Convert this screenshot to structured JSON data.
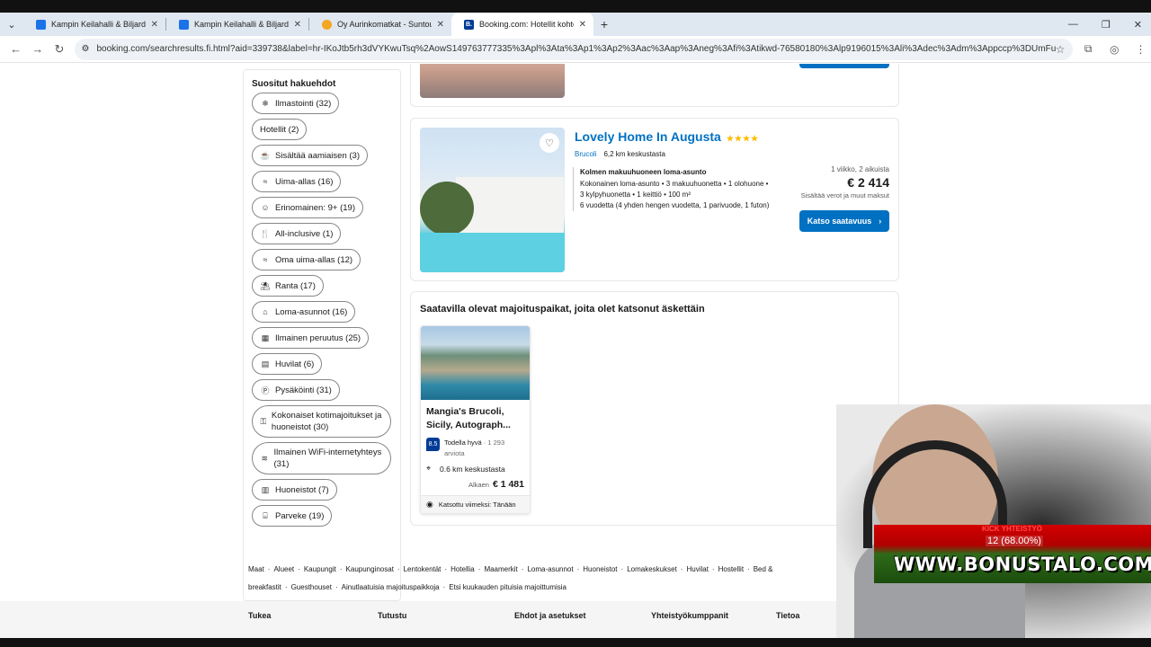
{
  "browser": {
    "tabs": [
      {
        "title": "Kampin Keilahalli & Biljardi Bar",
        "favicon_color": "#1a73e8",
        "active": false
      },
      {
        "title": "Kampin Keilahalli & Biljardi Bar",
        "favicon_color": "#1a73e8",
        "active": false
      },
      {
        "title": "Oy Aurinkomatkat - Suntours Lt",
        "favicon_color": "#f5a623",
        "active": false
      },
      {
        "title": "Booking.com: Hotellit kohteess",
        "favicon_color": "#003b95",
        "favicon_letter": "B.",
        "active": true
      }
    ],
    "url": "booking.com/searchresults.fi.html?aid=339738&label=hr-IKoJtb5rh3dVYKwuTsq%2AowS149763777335%3Apl%3Ata%3Ap1%3Ap2%3Aac%3Aap%3Aneg%3Afi%3Atikwd-76580180%3Alp9196015%3Ali%3Adec%3Adm%3Appccp%3DUmFuZG9tSVYkc2RIlyh..."
  },
  "sidebar": {
    "heading": "Suositut hakuehdot",
    "filters": [
      {
        "label": "Ilmastointi (32)",
        "icon": "snowflake-icon",
        "glyph": "❄"
      },
      {
        "label": "Hotellit (2)",
        "icon": "none",
        "glyph": ""
      },
      {
        "label": "Sisältää aamiaisen (3)",
        "icon": "coffee-icon",
        "glyph": "☕"
      },
      {
        "label": "Uima-allas (16)",
        "icon": "pool-icon",
        "glyph": "≈"
      },
      {
        "label": "Erinomainen: 9+ (19)",
        "icon": "smile-icon",
        "glyph": "☺"
      },
      {
        "label": "All-inclusive (1)",
        "icon": "cutlery-icon",
        "glyph": "🍴"
      },
      {
        "label": "Oma uima-allas (12)",
        "icon": "pool-icon",
        "glyph": "≈"
      },
      {
        "label": "Ranta (17)",
        "icon": "beach-icon",
        "glyph": "⛱"
      },
      {
        "label": "Loma-asunnot (16)",
        "icon": "house-icon",
        "glyph": "⌂"
      },
      {
        "label": "Ilmainen peruutus (25)",
        "icon": "calendar-icon",
        "glyph": "▦"
      },
      {
        "label": "Huvilat (6)",
        "icon": "villa-icon",
        "glyph": "▤"
      },
      {
        "label": "Pysäköinti (31)",
        "icon": "parking-icon",
        "glyph": "Ⓟ"
      },
      {
        "label": "Kokonaiset kotimajoitukset ja huoneistot (30)",
        "icon": "key-icon",
        "glyph": "⚿",
        "tall": true
      },
      {
        "label": "Ilmainen WiFi-internetyhteys (31)",
        "icon": "wifi-icon",
        "glyph": "≋",
        "tall": true
      },
      {
        "label": "Huoneistot (7)",
        "icon": "building-icon",
        "glyph": "▥"
      },
      {
        "label": "Parveke (19)",
        "icon": "balcony-icon",
        "glyph": "⌸"
      }
    ]
  },
  "listing": {
    "name": "Lovely Home In Augusta",
    "stars": "★★★★",
    "city": "Brucoli",
    "distance": "6,2 km keskustasta",
    "unit_title": "Kolmen makuuhuoneen loma-asunto",
    "unit_line1": "Kokonainen loma-asunto • 3 makuuhuonetta • 1 olohuone •",
    "unit_line2": "3 kylpyhuonetta • 1 keittiö • 100 m²",
    "unit_line3": "6 vuodetta (4 yhden hengen vuodetta, 1 parivuode, 1 futon)",
    "nights": "1 viikko, 2 aikuista",
    "price": "€ 2 414",
    "tax_note": "Sisältää verot ja muut maksut",
    "cta": "Katso saatavuus"
  },
  "recent": {
    "heading": "Saatavilla olevat majoituspaikat, joita olet katsonut äskettäin",
    "name": "Mangia's Brucoli, Sicily, Autograph...",
    "score": "8.5",
    "score_word": "Todella hyvä",
    "reviews": "· 1 293 arviota",
    "distance": "0.6 km keskustasta",
    "from_label": "Alkaen",
    "from_price": "€ 1 481",
    "seen": "Katsottu viimeksi: Tänään"
  },
  "footer": {
    "links": [
      "Maat",
      "Alueet",
      "Kaupungit",
      "Kaupunginosat",
      "Lentokentät",
      "Hotellia",
      "Maamerkit",
      "Loma-asunnot",
      "Huoneistot",
      "Lomakeskukset",
      "Huvilat",
      "Hostellit",
      "Bed & breakfastit",
      "Guesthouset",
      "Ainutlaatuisia majoituspaikkoja",
      "Etsi kuukauden pituisia majoittumisia"
    ],
    "columns": [
      "Tukea",
      "Tutustu",
      "Ehdot ja asetukset",
      "Yhteistyökumppanit",
      "Tietoa"
    ]
  },
  "overlay": {
    "kick_label": "KICK YHTEISTYÖ",
    "percent": "12 (68.00%)",
    "brand": "WWW.BONUSTALO.COM"
  }
}
